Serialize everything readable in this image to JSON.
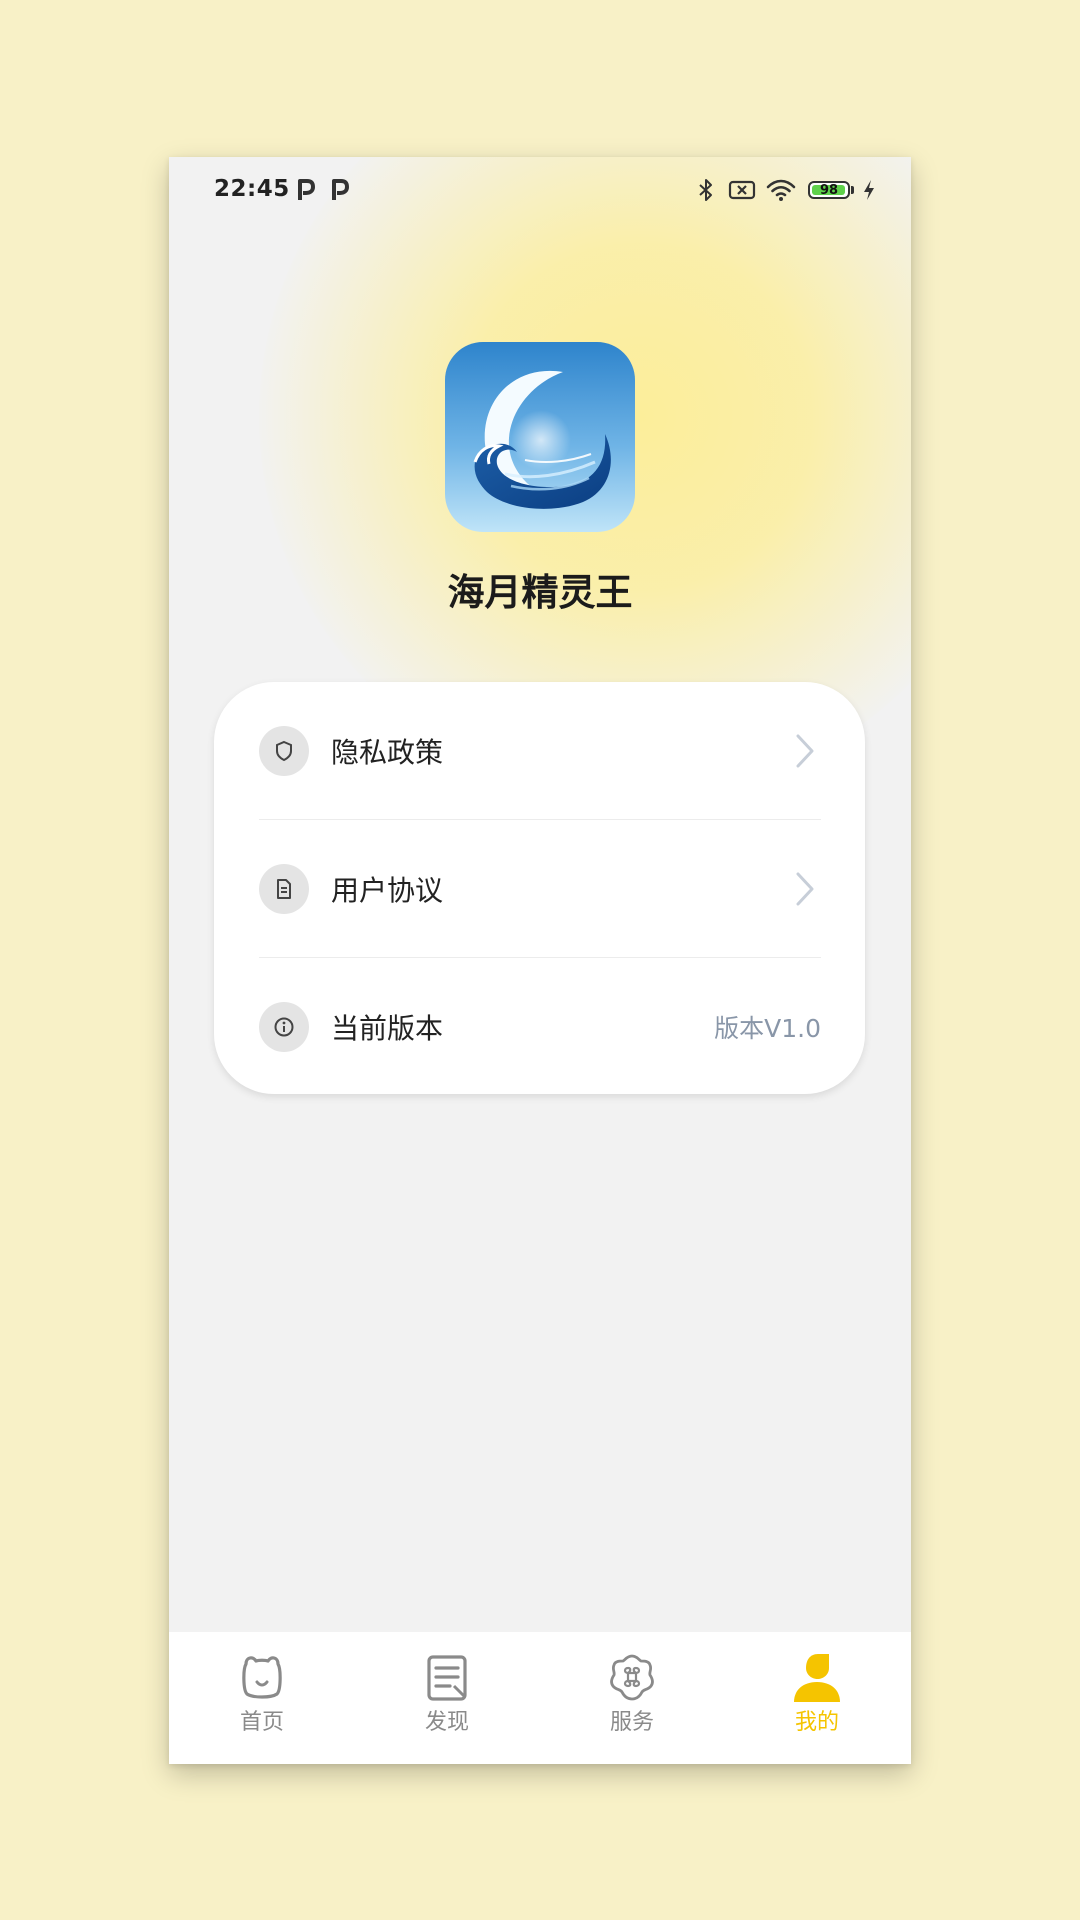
{
  "status_bar": {
    "time": "22:45",
    "battery_level": "98",
    "battery_fraction": 0.98
  },
  "app": {
    "name": "海月精灵王"
  },
  "menu": {
    "items": [
      {
        "label": "隐私政策",
        "icon": "shield-icon",
        "action": "chevron-right-icon"
      },
      {
        "label": "用户协议",
        "icon": "document-icon",
        "action": "chevron-right-icon"
      },
      {
        "label": "当前版本",
        "icon": "info-icon",
        "value": "版本V1.0"
      }
    ]
  },
  "tabbar": {
    "tabs": [
      {
        "label": "首页",
        "icon": "home-bear-icon",
        "active": false
      },
      {
        "label": "发现",
        "icon": "article-icon",
        "active": false
      },
      {
        "label": "服务",
        "icon": "command-flower-icon",
        "active": false
      },
      {
        "label": "我的",
        "icon": "person-icon",
        "active": true
      }
    ]
  },
  "colors": {
    "page_background": "#f8f1c7",
    "screen_background": "#f2f2f2",
    "glow": "#fcee9a",
    "active_tab": "#f5c400",
    "inactive_tab": "#8a8a8a",
    "version_text": "#8996a8",
    "battery_green": "#5fd14b"
  }
}
